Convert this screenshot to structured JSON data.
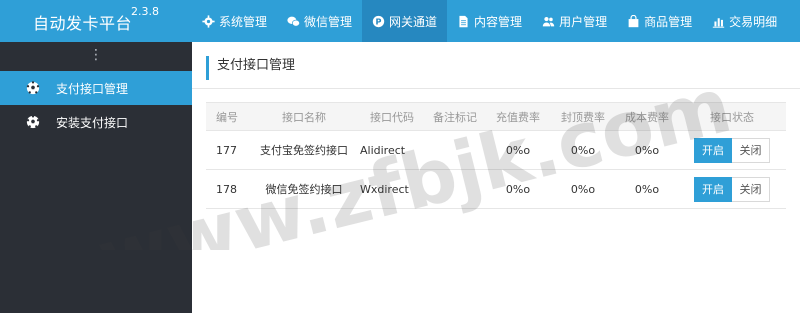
{
  "app": {
    "title": "自动发卡平台",
    "version": "2.3.8"
  },
  "nav": [
    {
      "label": "系统管理",
      "icon": "gear-icon",
      "active": false
    },
    {
      "label": "微信管理",
      "icon": "wechat-icon",
      "active": false
    },
    {
      "label": "网关通道",
      "icon": "gateway-p-icon",
      "active": true
    },
    {
      "label": "内容管理",
      "icon": "document-icon",
      "active": false
    },
    {
      "label": "用户管理",
      "icon": "users-icon",
      "active": false
    },
    {
      "label": "商品管理",
      "icon": "bag-icon",
      "active": false
    },
    {
      "label": "交易明细",
      "icon": "bar-chart-icon",
      "active": false
    }
  ],
  "sidebar": {
    "toggle": "⋮",
    "items": [
      {
        "label": "支付接口管理",
        "icon": "soccer-ball-icon",
        "active": true
      },
      {
        "label": "安装支付接口",
        "icon": "soccer-ball-icon",
        "active": false
      }
    ]
  },
  "page": {
    "title": "支付接口管理"
  },
  "table": {
    "columns": [
      "编号",
      "接口名称",
      "接口代码",
      "备注标记",
      "充值费率",
      "封顶费率",
      "成本费率",
      "接口状态"
    ],
    "rows": [
      {
        "id": "177",
        "name": "支付宝免签约接口",
        "code": "Alidirect",
        "remark": "",
        "recharge_rate": "0%o",
        "cap_rate": "0%o",
        "cost_rate": "0%o",
        "on_label": "开启",
        "off_label": "关闭",
        "status": "on"
      },
      {
        "id": "178",
        "name": "微信免签约接口",
        "code": "Wxdirect",
        "remark": "",
        "recharge_rate": "0%o",
        "cap_rate": "0%o",
        "cost_rate": "0%o",
        "on_label": "开启",
        "off_label": "关闭",
        "status": "on"
      }
    ]
  },
  "watermark": "www.zfbjk.com",
  "colors": {
    "accent": "#2f9fd7",
    "accent_dark": "#2688c0",
    "sidebar_bg": "#2b2f36"
  }
}
